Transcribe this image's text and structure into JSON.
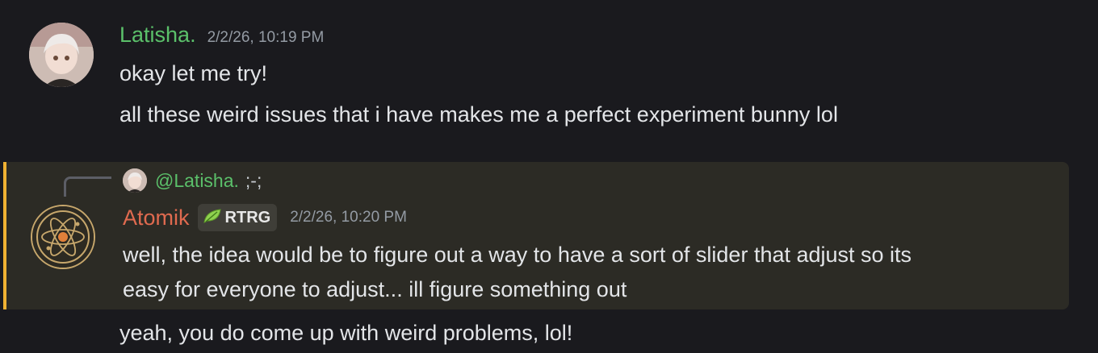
{
  "messages": [
    {
      "author": "Latisha.",
      "timestamp": "2/2/26, 10:19 PM",
      "lines": [
        "okay let me try!",
        "all these weird issues that i have makes me a perfect experiment bunny lol"
      ]
    },
    {
      "reply_to": {
        "mention": "@Latisha.",
        "text": ";-;"
      },
      "author": "Atomik",
      "tag": "RTRG",
      "timestamp": "2/2/26, 10:20 PM",
      "lines": [
        "well, the idea would be to figure out a way to have a sort of slider that adjust so its",
        "easy for everyone to adjust... ill figure something out"
      ]
    },
    {
      "lines": [
        "yeah, you do come up with weird problems, lol!"
      ]
    }
  ],
  "colors": {
    "background": "#1a1a1e",
    "highlight_bg": "#2c2b25",
    "highlight_border": "#f0b232",
    "latisha_name": "#5bc06a",
    "atomik_name": "#e06a4f"
  },
  "icons": {
    "latisha_avatar": "anime-avatar",
    "atomik_avatar": "atom-avatar",
    "tag_icon": "leaf-icon"
  }
}
